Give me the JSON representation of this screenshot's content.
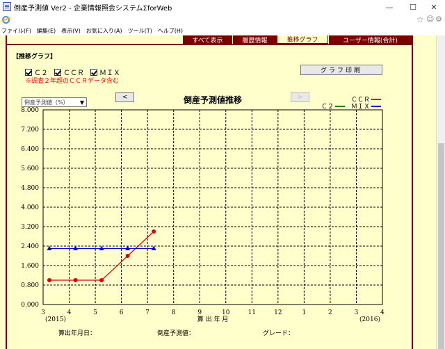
{
  "window": {
    "title": "倒産予測値 Ver2 - 企業情報照会システムΣforWeb",
    "min_glyph": "—",
    "max_glyph": "☐",
    "close_glyph": "✕"
  },
  "toolbar": {
    "icons": [
      "ie-icon",
      "star-icon",
      "smiley-icon",
      "gear-icon"
    ],
    "star_glyph": "☆",
    "smile_glyph": "☺",
    "gear_glyph": "⚙"
  },
  "menu": {
    "items": [
      {
        "label": "ファイル(F)"
      },
      {
        "label": "編集(E)"
      },
      {
        "label": "表示(V)"
      },
      {
        "label": "お気に入り(A)"
      },
      {
        "label": "ツール(T)"
      },
      {
        "label": "ヘルプ(H)"
      }
    ]
  },
  "tabs": [
    {
      "label": "すべて表示",
      "active": false
    },
    {
      "label": "履歴情報",
      "active": false
    },
    {
      "label": "推移グラフ",
      "active": true
    },
    {
      "label": "ユーザー情報(合計)",
      "active": false
    }
  ],
  "section": {
    "title": "【推移グラフ】"
  },
  "options": {
    "c2_label": "Ｃ２",
    "ccr_label": "ＣＣＲ",
    "mix_label": "ＭＩＸ",
    "note": "※調査２年超のＣＣＲデータ含む",
    "print_label": "グラフ印刷",
    "select_value": "倒産予測値（%）",
    "prev_label": "<",
    "next_label": ">"
  },
  "colors": {
    "ccr": "#e00000",
    "c2": "#008800",
    "mix": "#0000cc",
    "tab_bg": "#7a0000",
    "page_bg": "#ffffcc"
  },
  "chart_data": {
    "type": "line",
    "title": "倒産予測値推移",
    "xlabel": "算 出 年 月",
    "ylabel": "",
    "x_ticks": [
      "3",
      "4",
      "5",
      "6",
      "7",
      "8",
      "9",
      "10",
      "11",
      "12",
      "1",
      "2",
      "3",
      "4"
    ],
    "x_year_left": "(2015)",
    "x_year_right": "(2016)",
    "y_ticks": [
      "0.000",
      "0.800",
      "1.600",
      "2.400",
      "3.200",
      "4.000",
      "4.800",
      "5.600",
      "6.400",
      "7.200",
      "8.000"
    ],
    "ylim": [
      0,
      8
    ],
    "grid": true,
    "legend": [
      {
        "name": "ＣＣＲ",
        "color": "#e00000"
      },
      {
        "name": "Ｃ２",
        "color": "#008800"
      },
      {
        "name": "ＭＩＸ",
        "color": "#0000cc"
      }
    ],
    "series": [
      {
        "name": "ＣＣＲ",
        "marker": "circle",
        "color": "#e00000",
        "x": [
          "2015-03",
          "2015-04",
          "2015-05",
          "2015-06",
          "2015-07"
        ],
        "values": [
          1.0,
          1.0,
          1.0,
          2.0,
          3.0
        ]
      },
      {
        "name": "ＭＩＸ",
        "marker": "triangle",
        "color": "#0000cc",
        "x": [
          "2015-03",
          "2015-04",
          "2015-05",
          "2015-06",
          "2015-07"
        ],
        "values": [
          2.3,
          2.3,
          2.3,
          2.3,
          2.3
        ]
      }
    ]
  },
  "footer": {
    "calc_date_label": "算出年月日：",
    "prediction_label": "倒産予測値：",
    "grade_label": "グレード："
  }
}
